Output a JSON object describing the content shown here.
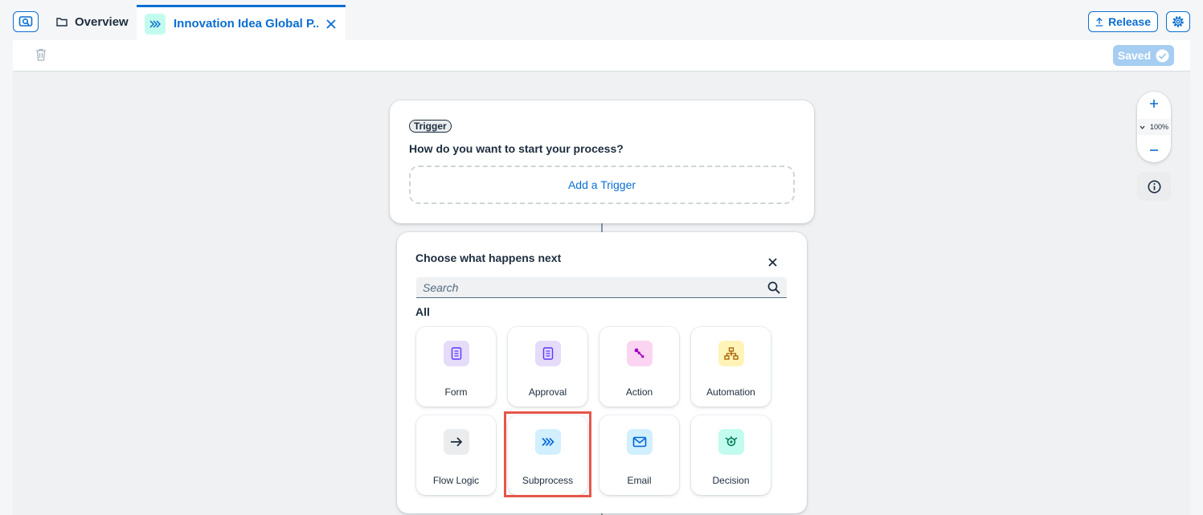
{
  "tabs": {
    "overview_label": "Overview",
    "active_label": "Innovation Idea Global P...",
    "release_label": "Release"
  },
  "toolbar": {
    "saved_label": "Saved"
  },
  "trigger": {
    "badge": "Trigger",
    "question": "How do you want to start your process?",
    "add_label": "Add a Trigger"
  },
  "next_step": {
    "title": "Choose what happens next",
    "search_placeholder": "Search",
    "section_label": "All",
    "tiles": [
      {
        "label": "Form",
        "icon": "form-icon",
        "color": "#e5dcf9"
      },
      {
        "label": "Approval",
        "icon": "approval-icon",
        "color": "#e5dcf9"
      },
      {
        "label": "Action",
        "icon": "action-icon",
        "color": "#fbd4f1"
      },
      {
        "label": "Automation",
        "icon": "automation-icon",
        "color": "#fff3b8"
      },
      {
        "label": "Flow Logic",
        "icon": "flow-logic-icon",
        "color": "#eaecee"
      },
      {
        "label": "Subprocess",
        "icon": "subprocess-icon",
        "color": "#d1efff"
      },
      {
        "label": "Email",
        "icon": "email-icon",
        "color": "#d1efff"
      },
      {
        "label": "Decision",
        "icon": "decision-icon",
        "color": "#c2fcee"
      }
    ]
  },
  "zoom": {
    "level": "100%"
  },
  "colors": {
    "accent": "#0a6ed1",
    "highlight": "#e5574a"
  }
}
